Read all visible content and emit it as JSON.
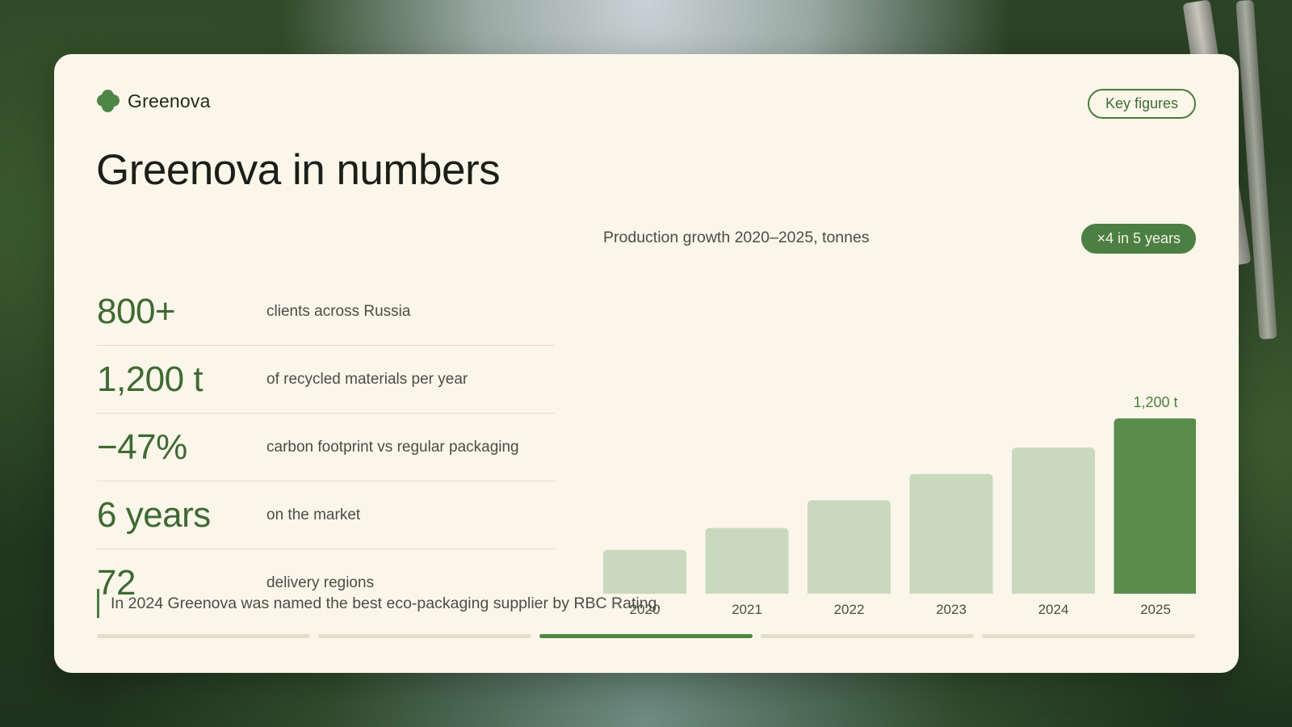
{
  "brand": {
    "name": "Greenova",
    "logo_icon": "clover-icon"
  },
  "header": {
    "key_figures_label": "Key figures"
  },
  "title": "Greenova in numbers",
  "stats": [
    {
      "value": "800+",
      "label": "clients across Russia"
    },
    {
      "value": "1,200 t",
      "label": "of recycled materials per year"
    },
    {
      "value": "−47%",
      "label": "carbon footprint vs regular packaging"
    },
    {
      "value": "6 years",
      "label": "on the market"
    },
    {
      "value": "72",
      "label": "delivery regions"
    }
  ],
  "chart_caption": "Production growth 2020–2025, tonnes",
  "growth_badge": "×4 in 5 years",
  "chart_data": {
    "type": "bar",
    "categories": [
      "2020",
      "2021",
      "2022",
      "2023",
      "2024",
      "2025"
    ],
    "values": [
      300,
      450,
      640,
      820,
      1000,
      1200
    ],
    "data_labels": [
      "",
      "",
      "",
      "",
      "",
      "1,200 t"
    ],
    "highlight_index": 5,
    "ylim": [
      0,
      1200
    ],
    "grid": false,
    "colors": {
      "bar": "#c9d9bd",
      "highlight": "#5a8c4c",
      "label": "#4c7f43"
    }
  },
  "quote": "In 2024 Greenova was named the best eco-packaging supplier by RBC Rating.",
  "progress": {
    "total": 5,
    "active_index": 2
  },
  "colors": {
    "accent": "#4e8645",
    "card_bg": "#fbf6ea",
    "text_dark": "#1b1f19"
  }
}
